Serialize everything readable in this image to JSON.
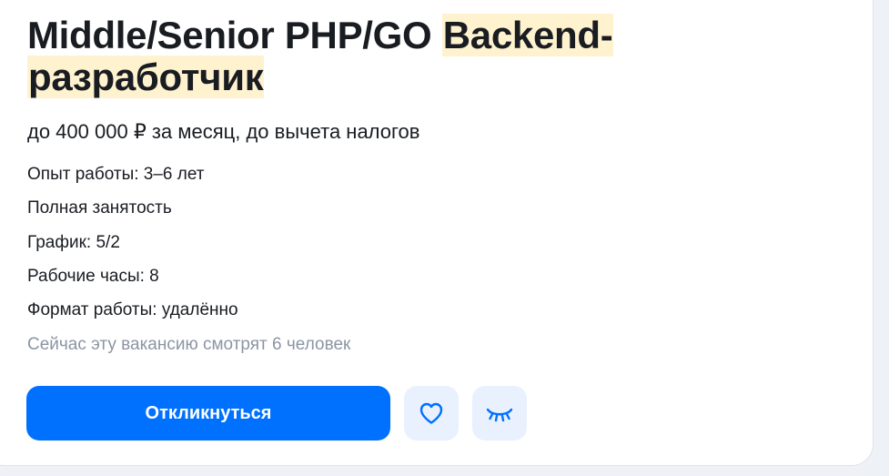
{
  "vacancy": {
    "title_plain": "Middle/Senior PHP/GO ",
    "title_highlight": "Backend-разработчик",
    "salary": "до 400 000 ₽ за месяц, до вычета налогов",
    "experience": "Опыт работы: 3–6 лет",
    "employment": "Полная занятость",
    "schedule": "График: 5/2",
    "working_hours": "Рабочие часы: 8",
    "work_format": "Формат работы: удалённо",
    "viewers": "Сейчас эту вакансию смотрят 6 человек"
  },
  "actions": {
    "apply_label": "Откликнуться",
    "favorite_icon": "heart-icon",
    "hide_icon": "closed-eye-icon"
  },
  "colors": {
    "primary": "#0070ff",
    "highlight": "#fff2cf",
    "icon_button_bg": "#e9f1fe",
    "muted_text": "#8b95a3",
    "text": "#191c21"
  }
}
